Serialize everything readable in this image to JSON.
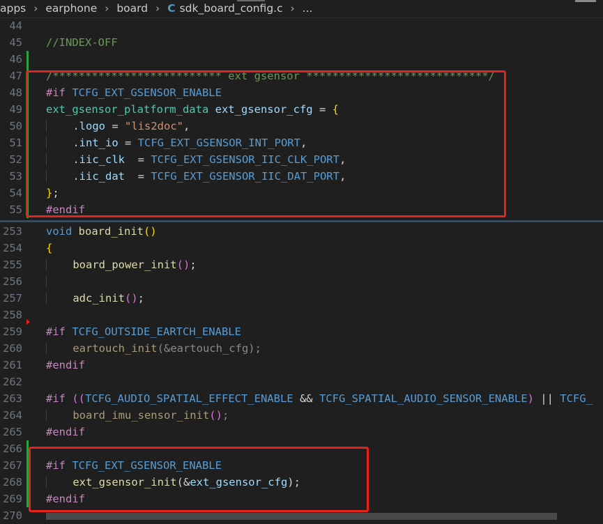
{
  "breadcrumb": {
    "items": [
      "apps",
      "earphone",
      "board"
    ],
    "file_icon": "C",
    "file": "sdk_board_config.c",
    "more": "..."
  },
  "colors": {
    "comment": "#6a9955",
    "keyword": "#c586c0",
    "macro": "#569cd6",
    "type": "#4ec9b0",
    "variable": "#9cdcfe",
    "function": "#dcdcaa",
    "string": "#ce9178",
    "highlight_box": "#e8211c",
    "modified_gutter": "#2ea043"
  },
  "editor": {
    "lines": [
      {
        "num": "44",
        "gutter": "",
        "tokens": []
      },
      {
        "num": "45",
        "gutter": "",
        "tokens": [
          {
            "c": "cm",
            "t": "//INDEX-OFF"
          }
        ]
      },
      {
        "num": "46",
        "gutter": "mod",
        "tokens": []
      },
      {
        "num": "47",
        "gutter": "mod",
        "tokens": [
          {
            "c": "cm",
            "t": "/************************** ext gsensor ****************************/"
          }
        ]
      },
      {
        "num": "48",
        "gutter": "mod",
        "tokens": [
          {
            "c": "kw",
            "t": "#if"
          },
          {
            "c": "pl",
            "t": " "
          },
          {
            "c": "mac",
            "t": "TCFG_EXT_GSENSOR_ENABLE"
          }
        ]
      },
      {
        "num": "49",
        "gutter": "mod",
        "tokens": [
          {
            "c": "ty",
            "t": "ext_gsensor_platform_data"
          },
          {
            "c": "pl",
            "t": " "
          },
          {
            "c": "var",
            "t": "ext_gsensor_cfg"
          },
          {
            "c": "pl",
            "t": " = "
          },
          {
            "c": "b1",
            "t": "{"
          }
        ]
      },
      {
        "num": "50",
        "gutter": "mod",
        "tokens": [
          {
            "c": "ind",
            "t": "    "
          },
          {
            "c": "var",
            "t": ".logo"
          },
          {
            "c": "pl",
            "t": " = "
          },
          {
            "c": "str",
            "t": "\"lis2doc\""
          },
          {
            "c": "pl",
            "t": ","
          }
        ]
      },
      {
        "num": "51",
        "gutter": "mod",
        "tokens": [
          {
            "c": "ind",
            "t": "    "
          },
          {
            "c": "var",
            "t": ".int_io"
          },
          {
            "c": "pl",
            "t": " = "
          },
          {
            "c": "mac",
            "t": "TCFG_EXT_GSENSOR_INT_PORT"
          },
          {
            "c": "pl",
            "t": ","
          }
        ]
      },
      {
        "num": "52",
        "gutter": "mod",
        "tokens": [
          {
            "c": "ind",
            "t": "    "
          },
          {
            "c": "var",
            "t": ".iic_clk"
          },
          {
            "c": "pl",
            "t": "  = "
          },
          {
            "c": "mac",
            "t": "TCFG_EXT_GSENSOR_IIC_CLK_PORT"
          },
          {
            "c": "pl",
            "t": ","
          }
        ]
      },
      {
        "num": "53",
        "gutter": "mod",
        "tokens": [
          {
            "c": "ind",
            "t": "    "
          },
          {
            "c": "var",
            "t": ".iic_dat"
          },
          {
            "c": "pl",
            "t": "  = "
          },
          {
            "c": "mac",
            "t": "TCFG_EXT_GSENSOR_IIC_DAT_PORT"
          },
          {
            "c": "pl",
            "t": ","
          }
        ]
      },
      {
        "num": "54",
        "gutter": "mod",
        "tokens": [
          {
            "c": "b1",
            "t": "}"
          },
          {
            "c": "pl",
            "t": ";"
          }
        ]
      },
      {
        "num": "55",
        "gutter": "mod",
        "tokens": [
          {
            "c": "kw",
            "t": "#endif"
          }
        ]
      },
      {
        "num": "253",
        "gutter": "",
        "tokens": [
          {
            "c": "mac",
            "t": "void"
          },
          {
            "c": "pl",
            "t": " "
          },
          {
            "c": "fn",
            "t": "board_init"
          },
          {
            "c": "b1",
            "t": "()"
          }
        ]
      },
      {
        "num": "254",
        "gutter": "",
        "tokens": [
          {
            "c": "b1",
            "t": "{"
          }
        ]
      },
      {
        "num": "255",
        "gutter": "",
        "tokens": [
          {
            "c": "ind",
            "t": "    "
          },
          {
            "c": "fn",
            "t": "board_power_init"
          },
          {
            "c": "b2",
            "t": "()"
          },
          {
            "c": "pl",
            "t": ";"
          }
        ]
      },
      {
        "num": "256",
        "gutter": "",
        "tokens": [
          {
            "c": "ind",
            "t": "    "
          }
        ]
      },
      {
        "num": "257",
        "gutter": "",
        "tokens": [
          {
            "c": "ind",
            "t": "    "
          },
          {
            "c": "fn",
            "t": "adc_init"
          },
          {
            "c": "b2",
            "t": "()"
          },
          {
            "c": "pl",
            "t": ";"
          }
        ]
      },
      {
        "num": "258",
        "gutter": "",
        "tokens": []
      },
      {
        "num": "259",
        "gutter": "",
        "tokens": [
          {
            "c": "kw",
            "t": "#if"
          },
          {
            "c": "pl",
            "t": " "
          },
          {
            "c": "mac",
            "t": "TCFG_OUTSIDE_EARTCH_ENABLE"
          }
        ]
      },
      {
        "num": "260",
        "gutter": "",
        "tokens": [
          {
            "c": "ind",
            "t": "    "
          },
          {
            "c": "dim2",
            "t": "eartouch_init"
          },
          {
            "c": "dim3",
            "t": "(&eartouch_cfg);"
          }
        ]
      },
      {
        "num": "261",
        "gutter": "",
        "tokens": [
          {
            "c": "kw",
            "t": "#endif"
          }
        ]
      },
      {
        "num": "262",
        "gutter": "",
        "tokens": []
      },
      {
        "num": "263",
        "gutter": "",
        "tokens": [
          {
            "c": "kw",
            "t": "#if"
          },
          {
            "c": "pl",
            "t": " "
          },
          {
            "c": "b2",
            "t": "(("
          },
          {
            "c": "mac",
            "t": "TCFG_AUDIO_SPATIAL_EFFECT_ENABLE"
          },
          {
            "c": "pl",
            "t": " && "
          },
          {
            "c": "mac",
            "t": "TCFG_SPATIAL_AUDIO_SENSOR_ENABLE"
          },
          {
            "c": "b2",
            "t": ")"
          },
          {
            "c": "pl",
            "t": " || "
          },
          {
            "c": "mac",
            "t": "TCFG_"
          }
        ]
      },
      {
        "num": "264",
        "gutter": "",
        "tokens": [
          {
            "c": "ind",
            "t": "    "
          },
          {
            "c": "dim2",
            "t": "board_imu_sensor_init"
          },
          {
            "c": "b2",
            "t": "()"
          },
          {
            "c": "dim3",
            "t": ";"
          }
        ]
      },
      {
        "num": "265",
        "gutter": "",
        "tokens": [
          {
            "c": "kw",
            "t": "#endif"
          }
        ]
      },
      {
        "num": "266",
        "gutter": "mod",
        "tokens": []
      },
      {
        "num": "267",
        "gutter": "mod",
        "tokens": [
          {
            "c": "kw",
            "t": "#if"
          },
          {
            "c": "pl",
            "t": " "
          },
          {
            "c": "mac",
            "t": "TCFG_EXT_GSENSOR_ENABLE"
          }
        ]
      },
      {
        "num": "268",
        "gutter": "mod",
        "tokens": [
          {
            "c": "ind",
            "t": "    "
          },
          {
            "c": "fn",
            "t": "ext_gsensor_init"
          },
          {
            "c": "pl",
            "t": "(&"
          },
          {
            "c": "var",
            "t": "ext_gsensor_cfg"
          },
          {
            "c": "pl",
            "t": ");"
          }
        ]
      },
      {
        "num": "269",
        "gutter": "mod",
        "tokens": [
          {
            "c": "kw",
            "t": "#endif"
          }
        ]
      },
      {
        "num": "270",
        "gutter": "",
        "tokens": []
      }
    ]
  }
}
